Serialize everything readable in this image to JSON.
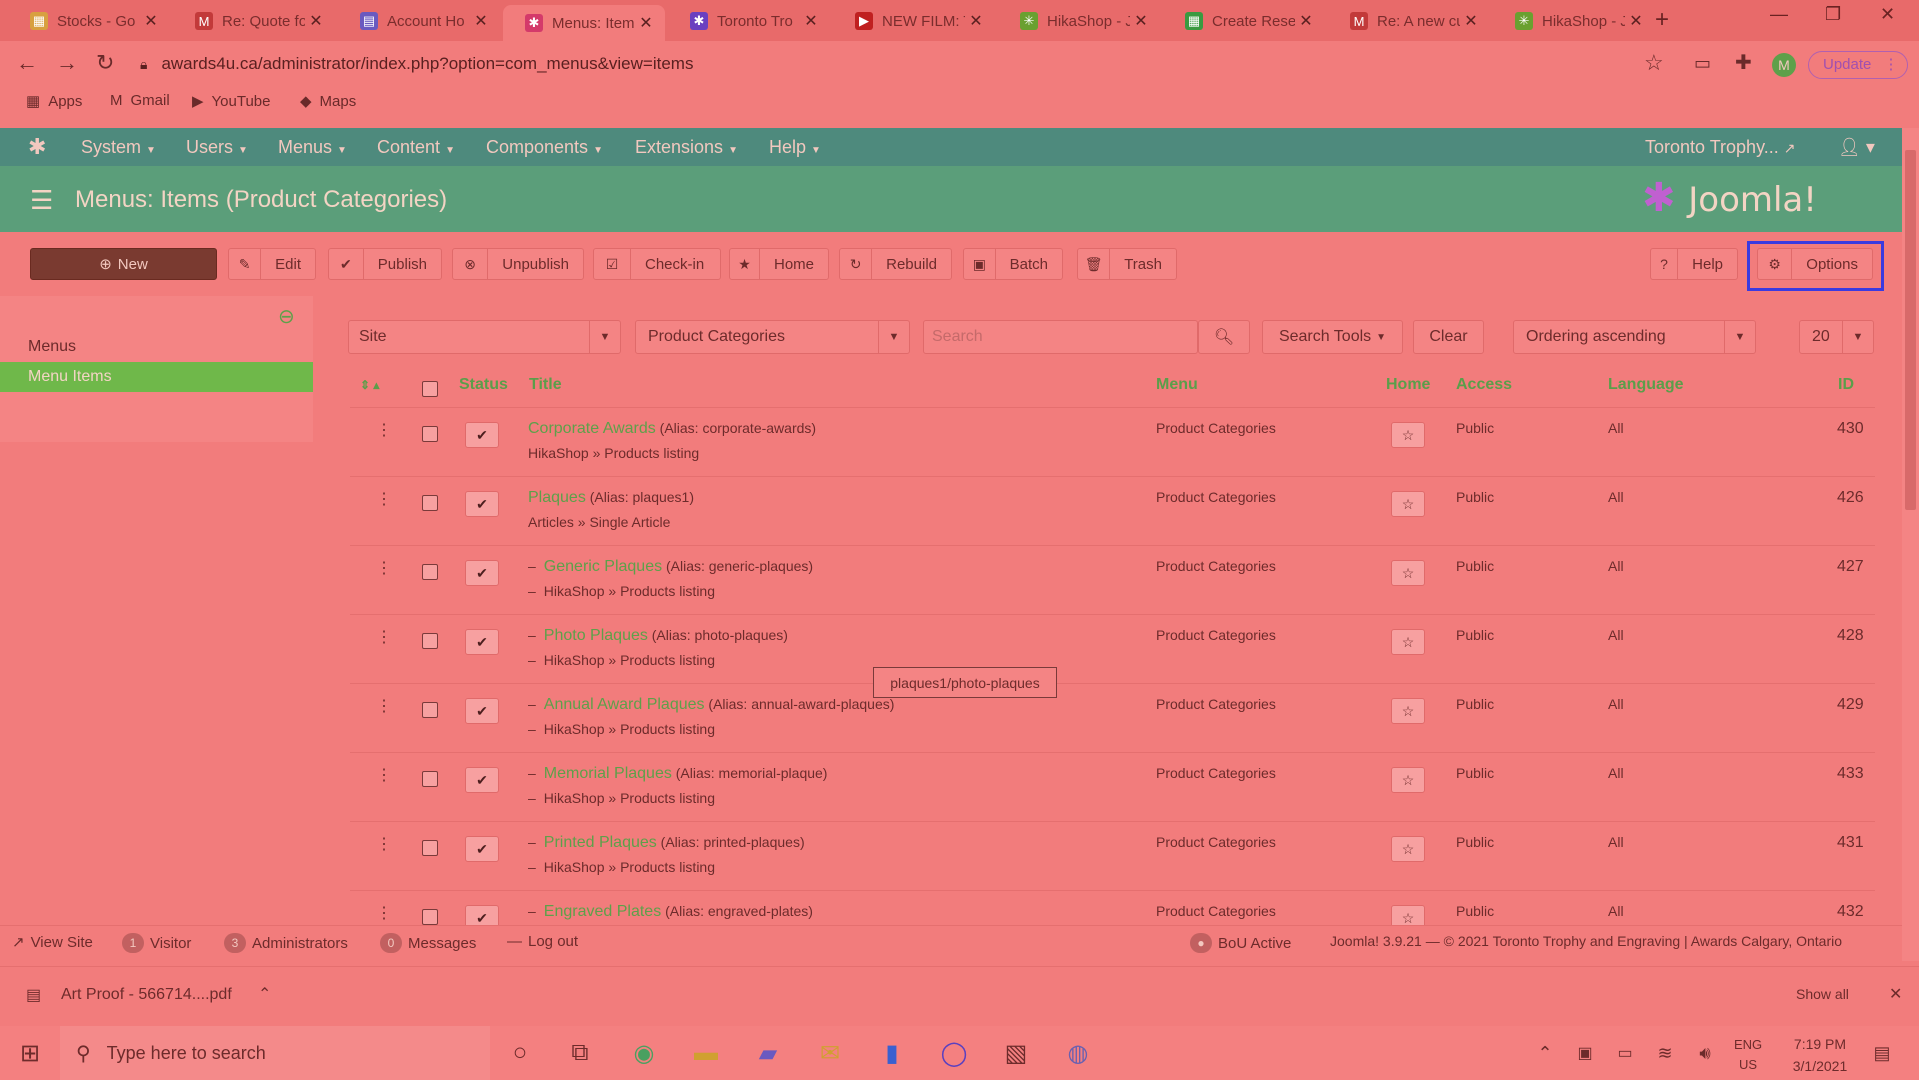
{
  "browser": {
    "tabs": [
      {
        "title": "Stocks - Go",
        "fav_color": "#d8a040",
        "fav": "▦"
      },
      {
        "title": "Re: Quote fo",
        "fav_color": "#c23a3a",
        "fav": "M"
      },
      {
        "title": "Account Ho",
        "fav_color": "#6a5ac0",
        "fav": "▤"
      },
      {
        "title": "Menus: Item",
        "fav_color": "#d43a6a",
        "fav": "✱",
        "active": true
      },
      {
        "title": "Toronto Tro",
        "fav_color": "#6a40c0",
        "fav": "✱"
      },
      {
        "title": "NEW FILM: T",
        "fav_color": "#c02020",
        "fav": "▶"
      },
      {
        "title": "HikaShop - J",
        "fav_color": "#6aa030",
        "fav": "✳"
      },
      {
        "title": "Create Rese",
        "fav_color": "#3a9a40",
        "fav": "▦"
      },
      {
        "title": "Re: A new cu",
        "fav_color": "#c23a3a",
        "fav": "M"
      },
      {
        "title": "HikaShop - J",
        "fav_color": "#6aa030",
        "fav": "✳"
      }
    ],
    "url": "awards4u.ca/administrator/index.php?option=com_menus&view=items",
    "update_label": "Update",
    "profile_initial": "M",
    "bookmarks": [
      {
        "label": "Apps",
        "icon": "▦"
      },
      {
        "label": "Gmail",
        "icon": "M"
      },
      {
        "label": "YouTube",
        "icon": "▶"
      },
      {
        "label": "Maps",
        "icon": "◆"
      }
    ]
  },
  "joomla": {
    "nav": [
      "System",
      "Users",
      "Menus",
      "Content",
      "Components",
      "Extensions",
      "Help"
    ],
    "site_name": "Toronto Trophy...",
    "page_title": "Menus: Items (Product Categories)",
    "logo_text": "Joomla!",
    "toolbar": {
      "new": "New",
      "edit": "Edit",
      "publish": "Publish",
      "unpublish": "Unpublish",
      "checkin": "Check-in",
      "home": "Home",
      "rebuild": "Rebuild",
      "batch": "Batch",
      "trash": "Trash",
      "help": "Help",
      "options": "Options"
    },
    "sidebar": {
      "items": [
        "Menus",
        "Menu Items"
      ]
    },
    "filters": {
      "site": "Site",
      "menu": "Product Categories",
      "search_placeholder": "Search",
      "search_tools": "Search Tools",
      "clear": "Clear",
      "ordering": "Ordering ascending",
      "limit": "20"
    },
    "columns": {
      "status": "Status",
      "title": "Title",
      "menu": "Menu",
      "home": "Home",
      "access": "Access",
      "language": "Language",
      "id": "ID"
    },
    "rows": [
      {
        "title": "Corporate Awards",
        "alias": "(Alias: corporate-awards)",
        "type": "HikaShop » Products listing",
        "prefix": "",
        "menu": "Product Categories",
        "access": "Public",
        "language": "All",
        "id": "430"
      },
      {
        "title": "Plaques",
        "alias": "(Alias: plaques1)",
        "type": "Articles » Single Article",
        "prefix": "",
        "menu": "Product Categories",
        "access": "Public",
        "language": "All",
        "id": "426"
      },
      {
        "title": "Generic Plaques",
        "alias": "(Alias: generic-plaques)",
        "type": "HikaShop » Products listing",
        "prefix": "–",
        "menu": "Product Categories",
        "access": "Public",
        "language": "All",
        "id": "427"
      },
      {
        "title": "Photo Plaques",
        "alias": "(Alias: photo-plaques)",
        "type": "HikaShop » Products listing",
        "prefix": "–",
        "menu": "Product Categories",
        "access": "Public",
        "language": "All",
        "id": "428"
      },
      {
        "title": "Annual Award Plaques",
        "alias": "(Alias: annual-award-plaques)",
        "type": "HikaShop » Products listing",
        "prefix": "–",
        "menu": "Product Categories",
        "access": "Public",
        "language": "All",
        "id": "429"
      },
      {
        "title": "Memorial Plaques",
        "alias": "(Alias: memorial-plaque)",
        "type": "HikaShop » Products listing",
        "prefix": "–",
        "menu": "Product Categories",
        "access": "Public",
        "language": "All",
        "id": "433"
      },
      {
        "title": "Printed Plaques",
        "alias": "(Alias: printed-plaques)",
        "type": "HikaShop » Products listing",
        "prefix": "–",
        "menu": "Product Categories",
        "access": "Public",
        "language": "All",
        "id": "431"
      },
      {
        "title": "Engraved Plates",
        "alias": "(Alias: engraved-plates)",
        "type": "",
        "prefix": "–",
        "menu": "Product Categories",
        "access": "Public",
        "language": "All",
        "id": "432"
      }
    ],
    "tooltip": "plaques1/photo-plaques",
    "statusbar": {
      "view_site": "View Site",
      "visitor_count": "1",
      "visitor_label": "Visitor",
      "admin_count": "3",
      "admin_label": "Administrators",
      "messages_count": "0",
      "messages_label": "Messages",
      "logout": "Log out",
      "bou": "BoU Active",
      "footer": "Joomla! 3.9.21 — © 2021 Toronto Trophy and Engraving | Awards Calgary, Ontario"
    }
  },
  "downloads": {
    "file": "Art Proof - 566714....pdf",
    "show_all": "Show all"
  },
  "taskbar": {
    "search_placeholder": "Type here to search",
    "lang1": "ENG",
    "lang2": "US",
    "time": "7:19 PM",
    "date": "3/1/2021"
  },
  "colors": {
    "accent_green": "#5ea04a",
    "header_teal": "#4e8a7d",
    "highlight_blue": "#3a3ae0"
  }
}
